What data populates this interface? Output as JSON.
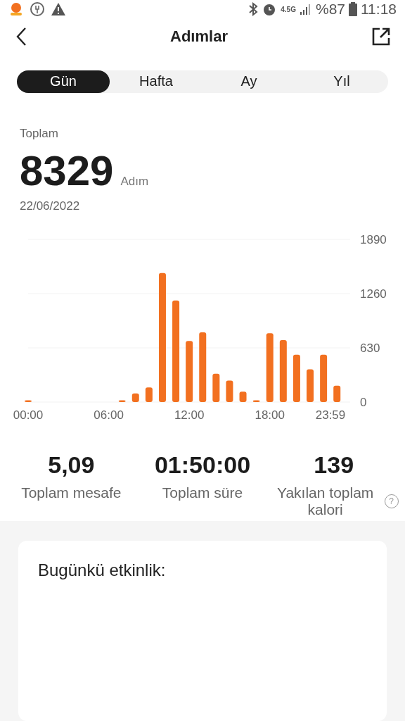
{
  "status_bar": {
    "battery": "%87",
    "time": "11:18",
    "network": "4.5G"
  },
  "header": {
    "title": "Adımlar"
  },
  "tabs": [
    {
      "label": "Gün",
      "selected": true
    },
    {
      "label": "Hafta",
      "selected": false
    },
    {
      "label": "Ay",
      "selected": false
    },
    {
      "label": "Yıl",
      "selected": false
    }
  ],
  "summary": {
    "label": "Toplam",
    "value": "8329",
    "unit": "Adım",
    "date": "22/06/2022"
  },
  "chart_data": {
    "type": "bar",
    "x": [
      0,
      60,
      120,
      180,
      240,
      300,
      360,
      420,
      480,
      540,
      600,
      660,
      720,
      780,
      840,
      900,
      960,
      1020,
      1080,
      1140,
      1200,
      1260,
      1320,
      1380
    ],
    "series": [
      {
        "color": "#f27020",
        "values": [
          20,
          0,
          0,
          0,
          0,
          0,
          0,
          20,
          100,
          170,
          1500,
          1180,
          710,
          810,
          330,
          250,
          120,
          20,
          800,
          720,
          550,
          380,
          550,
          190
        ]
      }
    ],
    "xlim": [
      0,
      1439
    ],
    "ylim": [
      0,
      1890
    ],
    "yticks": [
      0,
      630,
      1260,
      1890
    ],
    "xticks": [
      {
        "value": 0,
        "label": "00:00"
      },
      {
        "value": 360,
        "label": "06:00"
      },
      {
        "value": 720,
        "label": "12:00"
      },
      {
        "value": 1080,
        "label": "18:00"
      },
      {
        "value": 1439,
        "label": "23:59"
      }
    ]
  },
  "stats": [
    {
      "value": "5,09",
      "label": "Toplam mesafe"
    },
    {
      "value": "01:50:00",
      "label": "Toplam süre"
    },
    {
      "value": "139",
      "label": "Yakılan toplam kalori",
      "help": "?"
    }
  ],
  "activity": {
    "title": "Bugünkü etkinlik:"
  }
}
